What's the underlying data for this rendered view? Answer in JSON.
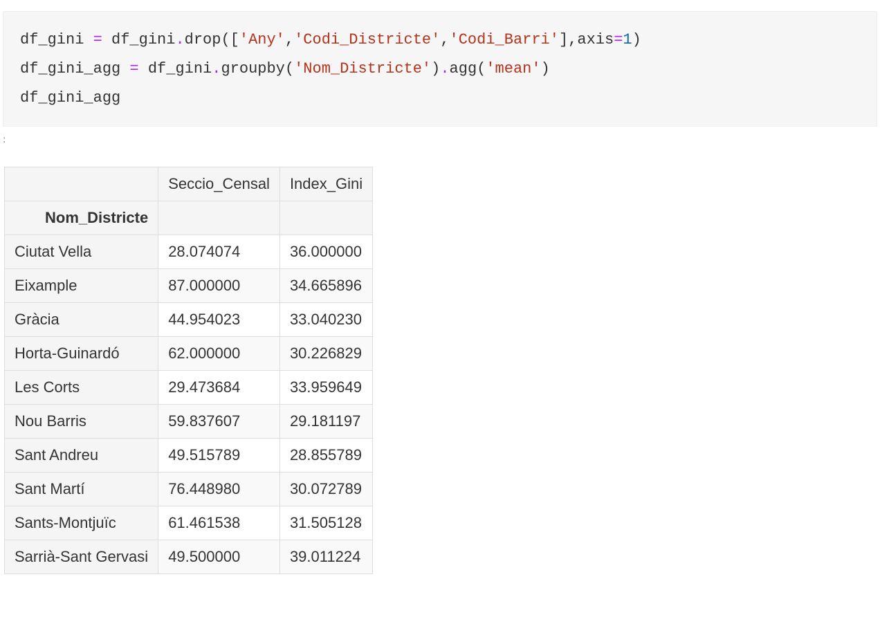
{
  "code": {
    "line1": {
      "lhs": "df_gini",
      "assign": " = ",
      "obj": "df_gini",
      "dot1": ".",
      "method": "drop",
      "open_b": "([",
      "s1": "'Any'",
      "c1": ",",
      "s2": "'Codi_Districte'",
      "c2": ",",
      "s3": "'Codi_Barri'",
      "close_b": "],",
      "kwarg": "axis",
      "eq": "=",
      "num": "1",
      "close_p": ")"
    },
    "line2": {
      "lhs": "df_gini_agg",
      "assign": " = ",
      "obj": "df_gini",
      "dot1": ".",
      "method1": "groupby",
      "open_p1": "(",
      "s1": "'Nom_Districte'",
      "close_p1": ")",
      "dot2": ".",
      "method2": "agg",
      "open_p2": "(",
      "s2": "'mean'",
      "close_p2": ")"
    },
    "line3": {
      "expr": "df_gini_agg"
    }
  },
  "out_marker": ":",
  "table": {
    "index_name": "Nom_Districte",
    "columns": [
      "Seccio_Censal",
      "Index_Gini"
    ],
    "rows": [
      {
        "idx": "Ciutat Vella",
        "c0": "28.074074",
        "c1": "36.000000"
      },
      {
        "idx": "Eixample",
        "c0": "87.000000",
        "c1": "34.665896"
      },
      {
        "idx": "Gràcia",
        "c0": "44.954023",
        "c1": "33.040230"
      },
      {
        "idx": "Horta-Guinardó",
        "c0": "62.000000",
        "c1": "30.226829"
      },
      {
        "idx": "Les Corts",
        "c0": "29.473684",
        "c1": "33.959649"
      },
      {
        "idx": "Nou Barris",
        "c0": "59.837607",
        "c1": "29.181197"
      },
      {
        "idx": "Sant Andreu",
        "c0": "49.515789",
        "c1": "28.855789"
      },
      {
        "idx": "Sant Martí",
        "c0": "76.448980",
        "c1": "30.072789"
      },
      {
        "idx": "Sants-Montjuïc",
        "c0": "61.461538",
        "c1": "31.505128"
      },
      {
        "idx": "Sarrià-Sant Gervasi",
        "c0": "49.500000",
        "c1": "39.011224"
      }
    ]
  }
}
